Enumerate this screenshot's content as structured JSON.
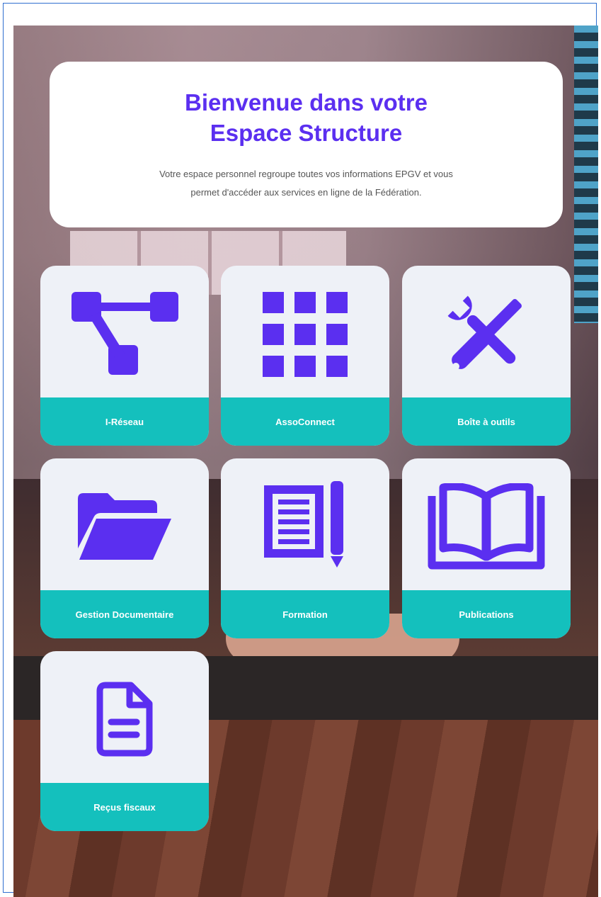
{
  "welcome": {
    "title_line1": "Bienvenue dans votre",
    "title_line2": "Espace Structure",
    "desc_line1": "Votre espace personnel regroupe toutes vos informations EPGV et vous",
    "desc_line2": "permet d'accéder aux services en ligne de la Fédération."
  },
  "tiles": [
    {
      "label": "I-Réseau",
      "icon": "network-icon"
    },
    {
      "label": "AssoConnect",
      "icon": "grid-icon"
    },
    {
      "label": "Boîte à outils",
      "icon": "tools-icon"
    },
    {
      "label": "Gestion Documentaire",
      "icon": "folder-icon"
    },
    {
      "label": "Formation",
      "icon": "document-pencil-icon"
    },
    {
      "label": "Publications",
      "icon": "open-book-icon"
    },
    {
      "label": "Reçus fiscaux",
      "icon": "file-icon"
    }
  ],
  "colors": {
    "accent": "#5b2ff0",
    "teal": "#14c0bd",
    "tile_bg": "#eef1f7"
  }
}
